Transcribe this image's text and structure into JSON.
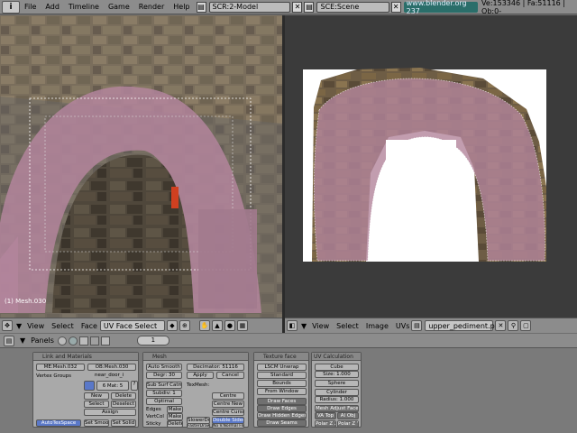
{
  "topbar": {
    "window_icon": "i",
    "menus": [
      "File",
      "Add",
      "Timeline",
      "Game",
      "Render",
      "Help"
    ],
    "screen_field": "SCR:2-Model",
    "scene_field": "SCE:Scene",
    "url": "www.blender.org 237",
    "stats": "Ve:153346 | Fa:51116 | Ob:0-"
  },
  "view3d": {
    "label": "(1) Mesh.030",
    "header": {
      "view": "View",
      "select": "Select",
      "face": "Face",
      "mode": "UV Face Select"
    }
  },
  "uveditor": {
    "header": {
      "view": "View",
      "select": "Select",
      "image": "Image",
      "uvs": "UVs",
      "image_name": "upper_pediment.png"
    }
  },
  "buttons": {
    "header": {
      "panels": "Panels",
      "frame": "1"
    },
    "link_materials": {
      "title": "Link and Materials",
      "me_field": "ME:Mesh.032",
      "ob_field": "OB:Mesh.030",
      "vertex_groups": "Vertex Groups",
      "mat_name": "near_door_i",
      "mat_count": "6 Mat: 5",
      "new": "New",
      "delete": "Delete",
      "select": "Select",
      "deselect": "Deselect",
      "assign": "Assign",
      "autotexspace": "AutoTexSpace",
      "set_smooth": "Set Smooth",
      "set_solid": "Set Solid"
    },
    "mesh": {
      "title": "Mesh",
      "auto_smooth": "Auto Smooth",
      "degr": "Degr: 30",
      "subsurf": "Sub Surf Catmull",
      "subdiv": "Subdiv: 1",
      "optimal": "Optimal",
      "decimator": "Decimator: 51116",
      "apply": "Apply",
      "cancel": "Cancel",
      "texmesh": "TexMesh:",
      "edges": "Edges",
      "vertcol": "VertCol",
      "texface": "TexFace",
      "sticky": "Sticky",
      "make": "Make",
      "delete": "Delete",
      "centre": "Centre",
      "centre_new": "Centre New",
      "centre_cursor": "Centre Cursor",
      "slowerdraw": "SlowerDraw",
      "fasterdraw": "FasterDraw",
      "double_sided": "Double Sided",
      "no_vnormal_flip": "No V.Normal Flip"
    },
    "texture_face": {
      "title": "Texture face",
      "lscm": "LSCM Unwrap",
      "standard": "Standard",
      "bounds": "Bounds",
      "from_window": "From Window",
      "draw_faces": "Draw Faces",
      "draw_edges": "Draw Edges",
      "draw_hidden": "Draw Hidden Edges",
      "draw_seams": "Draw Seams"
    },
    "uv_calc": {
      "title": "UV Calculation",
      "cube": "Cube",
      "size": "Size: 1.000",
      "sphere": "Sphere",
      "cylinder": "Cylinder",
      "radius": "Radius: 1.000",
      "mesh_adjust": "Mesh Adjust Face",
      "va_top": "VA Top",
      "al_obj": "Al Obj",
      "polar_zx": "Polar Z X",
      "polar_zy": "Polar Z Y"
    }
  },
  "colors": {
    "accent": "#5a78c8",
    "url_bg": "#2a6e6a",
    "selection": "#c890b4"
  }
}
